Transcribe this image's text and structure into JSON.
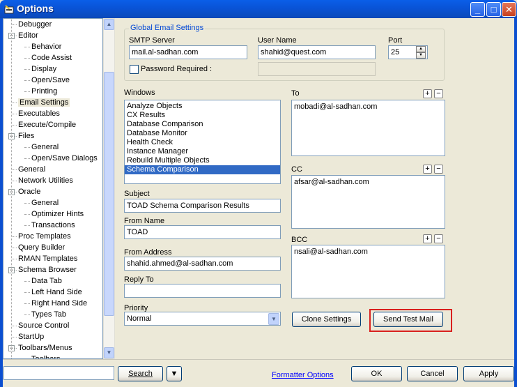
{
  "window": {
    "title": "Options",
    "minimize": "_",
    "maximize": "□",
    "close": "✕"
  },
  "tree": {
    "items": [
      {
        "label": "Debugger",
        "level": 1
      },
      {
        "label": "Editor",
        "level": 1,
        "expander": "−"
      },
      {
        "label": "Behavior",
        "level": 2
      },
      {
        "label": "Code Assist",
        "level": 2
      },
      {
        "label": "Display",
        "level": 2
      },
      {
        "label": "Open/Save",
        "level": 2
      },
      {
        "label": "Printing",
        "level": 2
      },
      {
        "label": "Email Settings",
        "level": 1,
        "selected": true
      },
      {
        "label": "Executables",
        "level": 1
      },
      {
        "label": "Execute/Compile",
        "level": 1
      },
      {
        "label": "Files",
        "level": 1,
        "expander": "−"
      },
      {
        "label": "General",
        "level": 2
      },
      {
        "label": "Open/Save Dialogs",
        "level": 2
      },
      {
        "label": "General",
        "level": 1
      },
      {
        "label": "Network Utilities",
        "level": 1
      },
      {
        "label": "Oracle",
        "level": 1,
        "expander": "−"
      },
      {
        "label": "General",
        "level": 2
      },
      {
        "label": "Optimizer Hints",
        "level": 2
      },
      {
        "label": "Transactions",
        "level": 2
      },
      {
        "label": "Proc Templates",
        "level": 1
      },
      {
        "label": "Query Builder",
        "level": 1
      },
      {
        "label": "RMAN Templates",
        "level": 1
      },
      {
        "label": "Schema Browser",
        "level": 1,
        "expander": "−"
      },
      {
        "label": "Data Tab",
        "level": 2
      },
      {
        "label": "Left Hand Side",
        "level": 2
      },
      {
        "label": "Right Hand Side",
        "level": 2
      },
      {
        "label": "Types Tab",
        "level": 2
      },
      {
        "label": "Source Control",
        "level": 1
      },
      {
        "label": "StartUp",
        "level": 1
      },
      {
        "label": "Toolbars/Menus",
        "level": 1,
        "expander": "−"
      },
      {
        "label": "Toolbars",
        "level": 2
      }
    ]
  },
  "global_email": {
    "group_title": "Global Email Settings",
    "smtp_label": "SMTP Server",
    "smtp_value": "mail.al-sadhan.com",
    "user_label": "User Name",
    "user_value": "shahid@quest.com",
    "port_label": "Port",
    "port_value": "25",
    "password_label": "Password Required :"
  },
  "windows": {
    "label": "Windows",
    "items": [
      "Analyze Objects",
      "CX Results",
      "Database Comparison",
      "Database Monitor",
      "Health Check",
      "Instance Manager",
      "Rebuild Multiple Objects",
      "Schema Comparison"
    ],
    "selected_index": 7
  },
  "subject": {
    "label": "Subject",
    "value": "TOAD Schema Comparison Results"
  },
  "from_name": {
    "label": "From Name",
    "value": "TOAD"
  },
  "from_address": {
    "label": "From Address",
    "value": "shahid.ahmed@al-sadhan.com"
  },
  "reply_to": {
    "label": "Reply To",
    "value": ""
  },
  "priority": {
    "label": "Priority",
    "value": "Normal"
  },
  "to": {
    "label": "To",
    "value": "mobadi@al-sadhan.com"
  },
  "cc": {
    "label": "CC",
    "value": "afsar@al-sadhan.com"
  },
  "bcc": {
    "label": "BCC",
    "value": "nsali@al-sadhan.com"
  },
  "add_symbol": "+",
  "remove_symbol": "−",
  "buttons": {
    "clone": "Clone Settings",
    "send_test": "Send Test Mail",
    "search": "Search",
    "ok": "OK",
    "cancel": "Cancel",
    "apply": "Apply"
  },
  "formatter_link": "Formatter Options",
  "search_value": "",
  "colors": {
    "titlebar": "#0a5fe8",
    "selection": "#316ac5",
    "highlight_box": "#d9201e",
    "link": "#0000ff"
  }
}
